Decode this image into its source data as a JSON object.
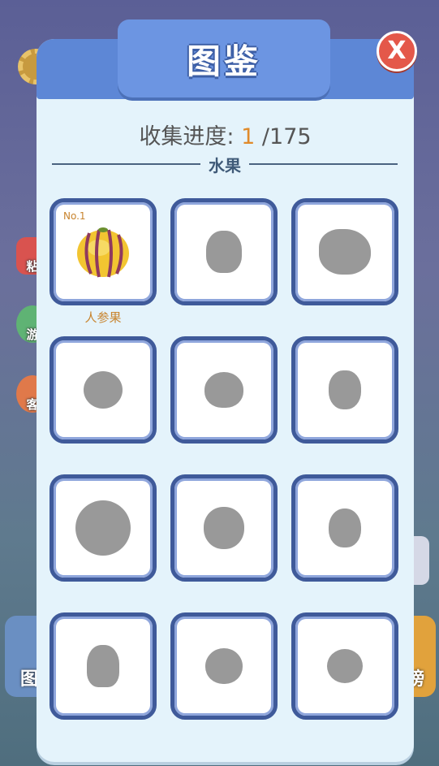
{
  "window": {
    "title": "图鉴",
    "close_label": "X"
  },
  "progress": {
    "label": "收集进度:",
    "current": "1",
    "total": "/175"
  },
  "section": {
    "title": "水果"
  },
  "background": {
    "side_labels": [
      "粘",
      "游",
      "客"
    ],
    "bottom_left_label": "图",
    "bottom_right_label": "榜"
  },
  "items": [
    {
      "no": "No.1",
      "name": "人参果",
      "collected": true,
      "icon": "pepino-fruit-icon"
    },
    {
      "collected": false,
      "icon": "locked-silhouette-icon"
    },
    {
      "collected": false,
      "icon": "locked-silhouette-icon"
    },
    {
      "collected": false,
      "icon": "locked-silhouette-icon"
    },
    {
      "collected": false,
      "icon": "locked-silhouette-icon"
    },
    {
      "collected": false,
      "icon": "locked-silhouette-icon"
    },
    {
      "collected": false,
      "icon": "locked-silhouette-icon"
    },
    {
      "collected": false,
      "icon": "locked-silhouette-icon"
    },
    {
      "collected": false,
      "icon": "locked-silhouette-icon"
    },
    {
      "collected": false,
      "icon": "locked-silhouette-icon"
    },
    {
      "collected": false,
      "icon": "locked-silhouette-icon"
    },
    {
      "collected": false,
      "icon": "locked-silhouette-icon"
    }
  ],
  "colors": {
    "accent": "#5d87d6",
    "highlight": "#e08a2a",
    "frame": "#3f5a9a",
    "silhouette": "#999999"
  }
}
